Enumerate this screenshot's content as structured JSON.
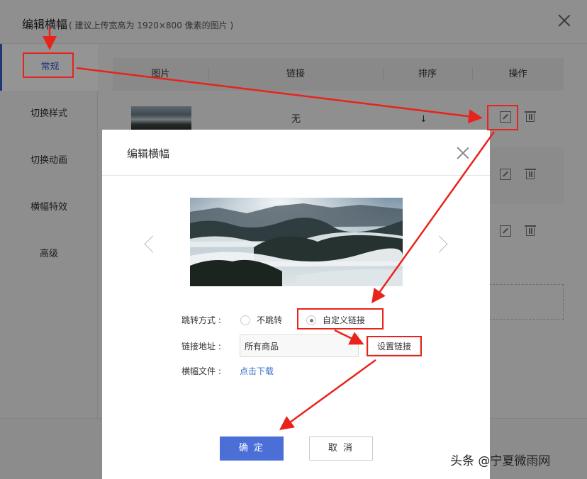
{
  "outer_dialog": {
    "title": "编辑横幅",
    "subtitle": "( 建议上传宽高为 1920×800 像素的图片 )",
    "sidebar": [
      "常规",
      "切换样式",
      "切换动画",
      "横幅特效",
      "高级"
    ],
    "table_headers": [
      "图片",
      "链接",
      "排序",
      "操作"
    ],
    "first_row": {
      "link": "无",
      "sort": "↓"
    }
  },
  "modal": {
    "title": "编辑横幅",
    "jump_label": "跳转方式 :",
    "radio_no_jump": "不跳转",
    "radio_custom": "自定义链接",
    "link_label": "链接地址 :",
    "link_value": "所有商品",
    "set_link_button": "设置链接",
    "file_label": "横幅文件 :",
    "download_link": "点击下载",
    "confirm_button": "确 定",
    "cancel_button": "取 消"
  },
  "watermark": "头条 @宁夏微雨网",
  "colors": {
    "accent": "#3b5ec8",
    "confirm": "#4b6fd6",
    "annotation": "#e8231c",
    "link": "#3b6fc8"
  }
}
